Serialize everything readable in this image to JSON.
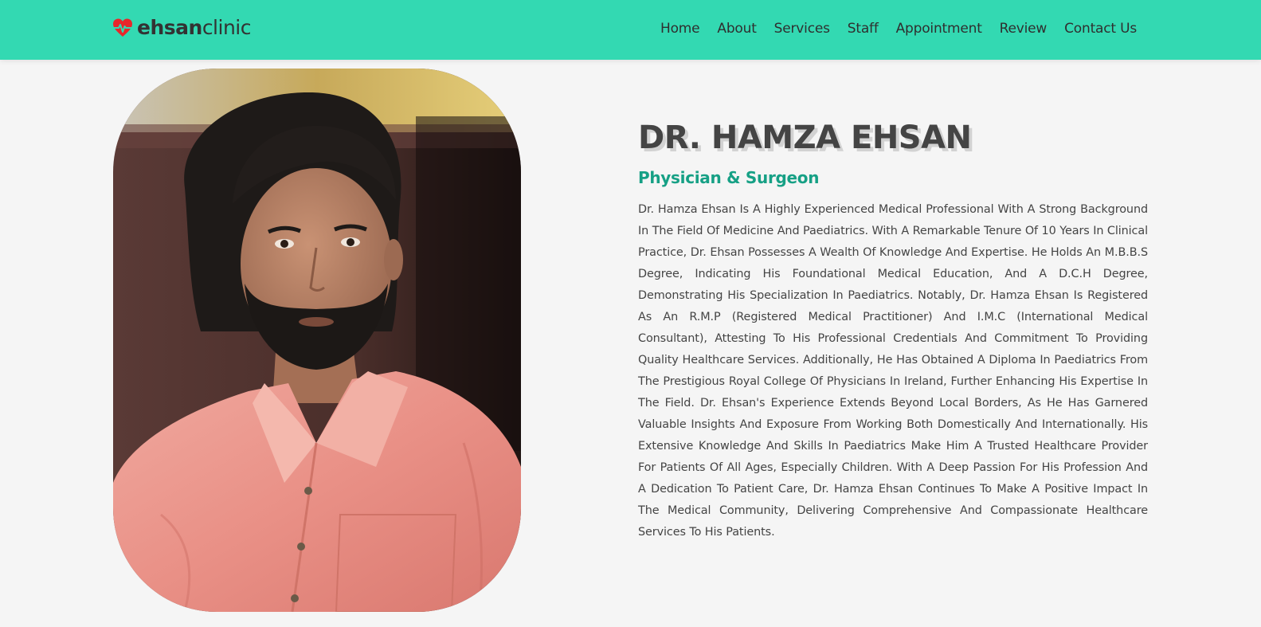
{
  "header": {
    "logo_bold": "ehsan",
    "logo_light": "clinic",
    "logo_icon": "heartbeat-icon",
    "background": "#33d9b2"
  },
  "nav": {
    "items": [
      {
        "label": "Home"
      },
      {
        "label": "About"
      },
      {
        "label": "Services"
      },
      {
        "label": "Staff"
      },
      {
        "label": "Appointment"
      },
      {
        "label": "Review"
      },
      {
        "label": "Contact Us"
      }
    ]
  },
  "profile": {
    "name": "DR. HAMZA EHSAN",
    "title": "Physician & Surgeon",
    "bio": "Dr. Hamza Ehsan Is A Highly Experienced Medical Professional With A Strong Background In The Field Of Medicine And Paediatrics. With A Remarkable Tenure Of 10 Years In Clinical Practice, Dr. Ehsan Possesses A Wealth Of Knowledge And Expertise. He Holds An M.B.B.S Degree, Indicating His Foundational Medical Education, And A D.C.H Degree, Demonstrating His Specialization In Paediatrics. Notably, Dr. Hamza Ehsan Is Registered As An R.M.P (Registered Medical Practitioner) And I.M.C (International Medical Consultant), Attesting To His Professional Credentials And Commitment To Providing Quality Healthcare Services. Additionally, He Has Obtained A Diploma In Paediatrics From The Prestigious Royal College Of Physicians In Ireland, Further Enhancing His Expertise In The Field. Dr. Ehsan's Experience Extends Beyond Local Borders, As He Has Garnered Valuable Insights And Exposure From Working Both Domestically And Internationally. His Extensive Knowledge And Skills In Paediatrics Make Him A Trusted Healthcare Provider For Patients Of All Ages, Especially Children. With A Deep Passion For His Profession And A Dedication To Patient Care, Dr. Hamza Ehsan Continues To Make A Positive Impact In The Medical Community, Delivering Comprehensive And Compassionate Healthcare Services To His Patients."
  },
  "colors": {
    "accent": "#33d9b2",
    "subtitle": "#16a085",
    "heart": "#e8262a"
  }
}
